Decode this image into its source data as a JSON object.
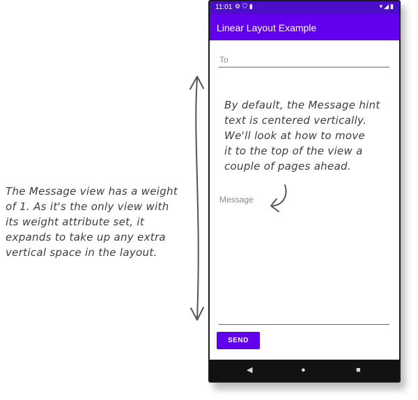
{
  "status_bar": {
    "time": "11:01",
    "left_icons": [
      "gear-icon",
      "shield-icon",
      "sd-card-icon"
    ],
    "right_icons": [
      "wifi-icon",
      "signal-icon",
      "battery-icon"
    ]
  },
  "app_bar": {
    "title": "Linear Layout Example"
  },
  "form": {
    "to_hint": "To",
    "message_hint": "Message",
    "send_label": "SEND"
  },
  "nav_bar": {
    "icons": [
      "back-icon",
      "home-icon",
      "recents-icon"
    ]
  },
  "annotations": {
    "top_lines": [
      "By default, the Message hint",
      "text is centered vertically.",
      "We'll look at how to move",
      "it to the top of the view a",
      "couple of pages ahead."
    ],
    "left_lines": [
      "The Message view has a weight",
      "of 1. As it's the only view with",
      "its weight attribute set, it",
      "expands to take up any extra",
      "vertical space in the layout."
    ]
  },
  "colors": {
    "primary": "#6200ee",
    "status_bar": "#4a0fc7",
    "nav_bar": "#121212",
    "hint_text": "#8a8a8a"
  }
}
